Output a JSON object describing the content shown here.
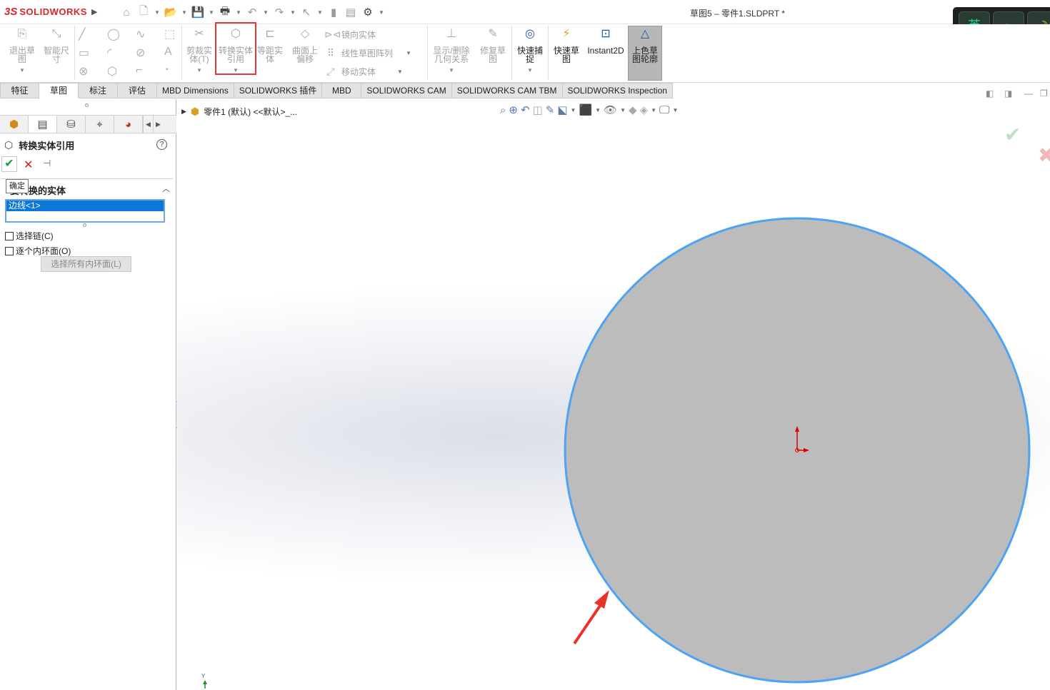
{
  "app": {
    "brand_mark": "3S",
    "brand_name": "SOLIDWORKS",
    "doc_title": "草图5 – 零件1.SLDPRT *"
  },
  "ime": {
    "keys": [
      "英",
      "•,",
      "☽"
    ]
  },
  "ribbon": {
    "exit_sketch": "退出草图",
    "smart_dim": "智能尺寸",
    "trim": "剪裁实体(T)",
    "convert": "转换实体引用",
    "offset": "等距实体",
    "surface_offset": "曲面上偏移",
    "mirror": "镜向实体",
    "linear_pattern": "线性草图阵列",
    "move": "移动实体",
    "display_delete": "显示/删除几何关系",
    "repair": "修复草图",
    "quick_snaps": "快速捕捉",
    "rapid_sketch": "快速草图",
    "instant2d": "Instant2D",
    "shaded_contours": "上色草图轮廓"
  },
  "tabs": [
    "特征",
    "草图",
    "标注",
    "评估",
    "MBD Dimensions",
    "SOLIDWORKS 插件",
    "MBD",
    "SOLIDWORKS CAM",
    "SOLIDWORKS CAM TBM",
    "SOLIDWORKS Inspection"
  ],
  "panel": {
    "title": "转换实体引用",
    "help": "?",
    "tooltip": "确定",
    "group_title": "要转换的实体",
    "selection": "边线<1>",
    "select_chain": "选择链(C)",
    "inner_loops": "逐个内环面(O)",
    "select_all_loops": "选择所有内环面(L)"
  },
  "viewport": {
    "tree_label": "零件1 (默认) <<默认>_...",
    "triad_label": "Y"
  },
  "colors": {
    "accent": "#0b78d7",
    "highlight": "#e23a3a",
    "circle_fill": "#bcbcbc",
    "circle_edge": "#4da3f4",
    "origin": "#e00000",
    "arrow": "#e8322a"
  }
}
